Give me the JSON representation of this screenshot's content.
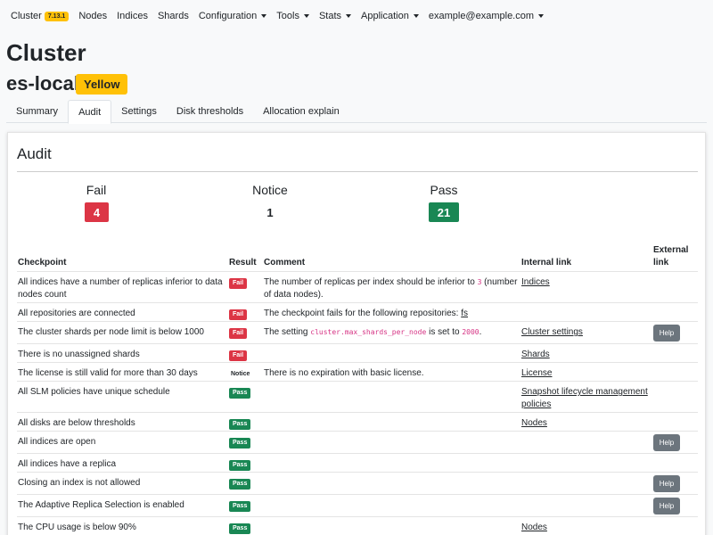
{
  "nav": {
    "brand": "Cluster",
    "version": "7.13.1",
    "items": [
      "Nodes",
      "Indices",
      "Shards",
      "Configuration",
      "Tools",
      "Stats",
      "Application",
      "example@example.com"
    ]
  },
  "header": {
    "title": "Cluster",
    "cluster_name": "es-local",
    "status": "Yellow"
  },
  "tabs": [
    "Summary",
    "Audit",
    "Settings",
    "Disk thresholds",
    "Allocation explain"
  ],
  "audit": {
    "title": "Audit",
    "summary": {
      "fail_label": "Fail",
      "fail_count": "4",
      "notice_label": "Notice",
      "notice_count": "1",
      "pass_label": "Pass",
      "pass_count": "21"
    },
    "columns": {
      "checkpoint": "Checkpoint",
      "result": "Result",
      "comment": "Comment",
      "internal": "Internal link",
      "external_1": "External",
      "external_2": "link"
    },
    "help_label": "Help",
    "rows": [
      {
        "checkpoint": [
          "All indices have a number of replicas inferior to data",
          "nodes count"
        ],
        "result": "Fail",
        "comment_a": "The number of replicas per index should be inferior to ",
        "comment_code": "3",
        "comment_b": " (number",
        "comment_line2": "of data nodes).",
        "link": "Indices"
      },
      {
        "checkpoint": [
          "All repositories are connected"
        ],
        "result": "Fail",
        "comment_a": "The checkpoint fails for the following repositories: ",
        "comment_link": "fs"
      },
      {
        "checkpoint": [
          "The cluster shards per node limit is below 1000"
        ],
        "result": "Fail",
        "comment_a": "The setting ",
        "comment_code": "cluster.max_shards_per_node",
        "comment_b": " is set to ",
        "comment_code2": "2000",
        "comment_c": ".",
        "link": "Cluster settings",
        "help": true
      },
      {
        "checkpoint": [
          "There is no unassigned shards"
        ],
        "result": "Fail",
        "link": "Shards"
      },
      {
        "checkpoint": [
          "The license is still valid for more than 30 days"
        ],
        "result": "Notice",
        "comment_a": "There is no expiration with basic license.",
        "link": "License"
      },
      {
        "checkpoint": [
          "All SLM policies have unique schedule"
        ],
        "result": "Pass",
        "link": "Snapshot lifecycle management",
        "link2": "policies"
      },
      {
        "checkpoint": [
          "All disks are below thresholds"
        ],
        "result": "Pass",
        "link": "Nodes"
      },
      {
        "checkpoint": [
          "All indices are open"
        ],
        "result": "Pass",
        "help": true
      },
      {
        "checkpoint": [
          "All indices have a replica"
        ],
        "result": "Pass"
      },
      {
        "checkpoint": [
          "Closing an index is not allowed"
        ],
        "result": "Pass",
        "help": true
      },
      {
        "checkpoint": [
          "The Adaptive Replica Selection is enabled"
        ],
        "result": "Pass",
        "help": true
      },
      {
        "checkpoint": [
          "The CPU usage is below 90%"
        ],
        "result": "Pass",
        "link": "Nodes"
      }
    ]
  }
}
